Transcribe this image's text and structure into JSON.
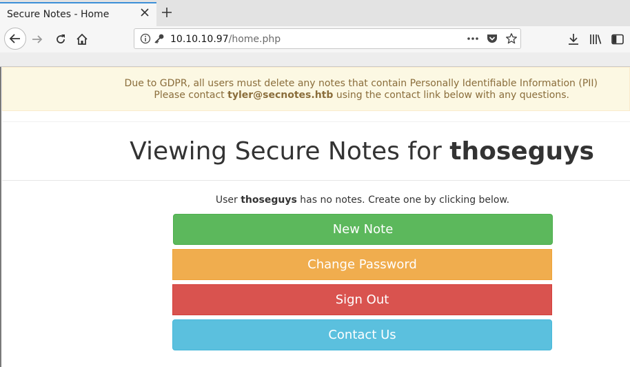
{
  "browser": {
    "tab_title": "Secure Notes - Home",
    "url_host": "10.10.10.97",
    "url_path": "/home.php"
  },
  "alert": {
    "line1": "Due to GDPR, all users must delete any notes that contain Personally Identifiable Information (PII)",
    "line2_prefix": "Please contact ",
    "email": "tyler@secnotes.htb",
    "line2_suffix": " using the contact link below with any questions."
  },
  "heading": {
    "prefix": "Viewing Secure Notes for ",
    "username": "thoseguys"
  },
  "info": {
    "prefix": "User ",
    "username": "thoseguys",
    "suffix": " has no notes. Create one by clicking below."
  },
  "buttons": {
    "new_note": "New Note",
    "change_password": "Change Password",
    "sign_out": "Sign Out",
    "contact_us": "Contact Us"
  },
  "colors": {
    "success": "#5cb85c",
    "warning": "#f0ad4e",
    "danger": "#d9534f",
    "info": "#5bc0de",
    "alert_bg": "#fcf8e3",
    "alert_text": "#8a6d3b"
  }
}
